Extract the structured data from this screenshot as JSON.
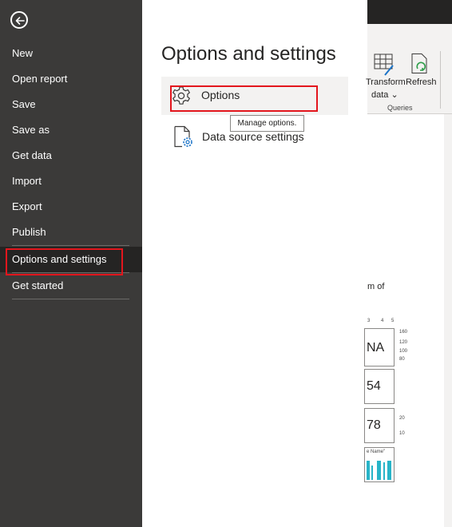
{
  "sidebar": {
    "items": [
      {
        "label": "New"
      },
      {
        "label": "Open report"
      },
      {
        "label": "Save"
      },
      {
        "label": "Save as"
      },
      {
        "label": "Get data"
      },
      {
        "label": "Import"
      },
      {
        "label": "Export"
      },
      {
        "label": "Publish"
      },
      {
        "label": "Options and settings",
        "active": true
      },
      {
        "label": "Get started"
      }
    ]
  },
  "panel": {
    "title": "Options and settings",
    "options_label": "Options",
    "datasource_label": "Data source settings",
    "tooltip": "Manage options."
  },
  "ribbon": {
    "transform_label": "Transform",
    "transform_sub": "data",
    "refresh_label": "Refresh",
    "group_label": "Queries"
  },
  "canvas": {
    "text_fragment": "m of",
    "axis_top_ticks": [
      "3",
      "4",
      "5"
    ],
    "card1_value": "NA",
    "card1_ticks": [
      "160",
      "120",
      "100",
      "80"
    ],
    "card2_value": "54",
    "card3_value": "78",
    "card3_ticks": [
      "20",
      "10"
    ],
    "chart_title": "e Name\""
  },
  "colors": {
    "sidebar_bg": "#3b3a39",
    "active_bg": "#252423",
    "highlight_red": "#e3161d",
    "accent_teal": "#28b4c8"
  }
}
